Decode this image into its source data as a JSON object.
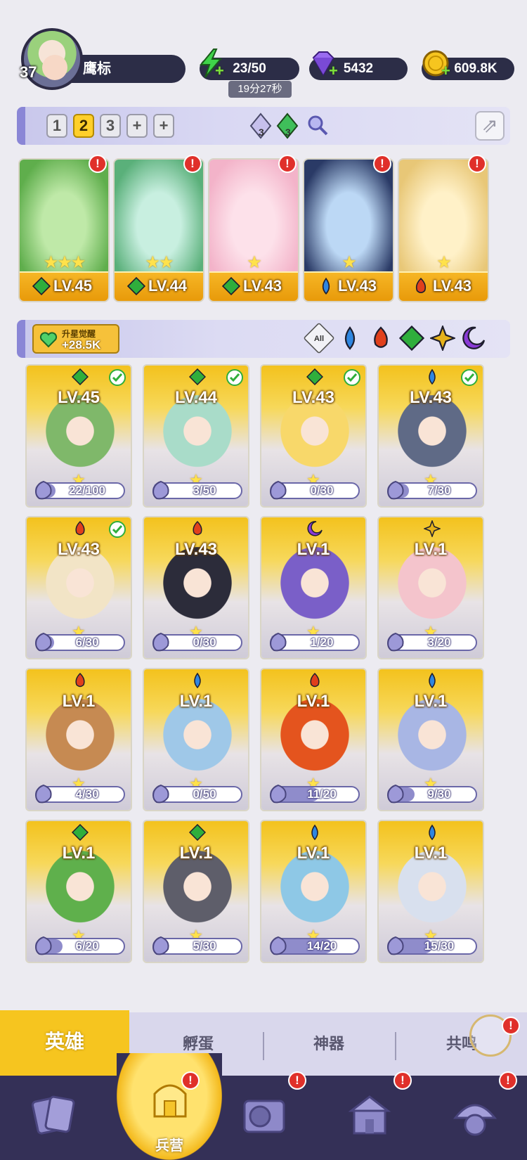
{
  "player": {
    "level": "37",
    "name": "鹰标"
  },
  "resources": {
    "energy": {
      "value": "23/50",
      "timer": "19分27秒",
      "icon": "lightning-icon"
    },
    "gems": {
      "value": "5432",
      "icon": "gem-icon"
    },
    "gold": {
      "value": "609.8K",
      "icon": "coin-icon"
    }
  },
  "team_bar": {
    "teams": [
      "1",
      "2",
      "3",
      "+",
      "+"
    ],
    "active_team": "2",
    "crystals": [
      {
        "icon": "ice-crystal-icon",
        "count": "3"
      },
      {
        "icon": "green-crystal-icon",
        "count": "3"
      }
    ]
  },
  "team_heroes": [
    {
      "level": "LV.45",
      "element": "leaf",
      "stars": "★★★",
      "alert": "!"
    },
    {
      "level": "LV.44",
      "element": "leaf",
      "stars": "★★",
      "alert": "!"
    },
    {
      "level": "LV.43",
      "element": "leaf",
      "stars": "★",
      "alert": "!"
    },
    {
      "level": "LV.43",
      "element": "water",
      "stars": "★",
      "alert": "!"
    },
    {
      "level": "LV.43",
      "element": "fire",
      "stars": "★",
      "alert": "!"
    }
  ],
  "filter_bar": {
    "awaken_title": "升星觉醒",
    "awaken_value": "+28.5K",
    "filters": [
      "All",
      "water",
      "fire",
      "leaf",
      "light",
      "dark"
    ],
    "all_label": "All"
  },
  "heroes": [
    {
      "level": "LV.45",
      "element": "leaf",
      "check": true,
      "shards": "22/100",
      "progress": 0.22
    },
    {
      "level": "LV.44",
      "element": "leaf",
      "check": true,
      "shards": "3/50",
      "progress": 0.06
    },
    {
      "level": "LV.43",
      "element": "leaf",
      "check": true,
      "shards": "0/30",
      "progress": 0.0
    },
    {
      "level": "LV.43",
      "element": "water",
      "check": true,
      "shards": "7/30",
      "progress": 0.23
    },
    {
      "level": "LV.43",
      "element": "fire",
      "check": true,
      "shards": "6/30",
      "progress": 0.2
    },
    {
      "level": "LV.43",
      "element": "fire",
      "check": false,
      "shards": "0/30",
      "progress": 0.0
    },
    {
      "level": "LV.1",
      "element": "dark",
      "check": false,
      "shards": "1/20",
      "progress": 0.05
    },
    {
      "level": "LV.1",
      "element": "light",
      "check": false,
      "shards": "3/20",
      "progress": 0.15
    },
    {
      "level": "LV.1",
      "element": "fire",
      "check": false,
      "shards": "4/30",
      "progress": 0.13
    },
    {
      "level": "LV.1",
      "element": "water",
      "check": false,
      "shards": "0/50",
      "progress": 0.0
    },
    {
      "level": "LV.1",
      "element": "fire",
      "check": false,
      "shards": "11/20",
      "progress": 0.55
    },
    {
      "level": "LV.1",
      "element": "water",
      "check": false,
      "shards": "9/30",
      "progress": 0.3
    },
    {
      "level": "LV.1",
      "element": "leaf",
      "check": false,
      "shards": "6/20",
      "progress": 0.3
    },
    {
      "level": "LV.1",
      "element": "leaf",
      "check": false,
      "shards": "5/30",
      "progress": 0.17
    },
    {
      "level": "LV.1",
      "element": "water",
      "check": false,
      "shards": "14/20",
      "progress": 0.7
    },
    {
      "level": "LV.1",
      "element": "water",
      "check": false,
      "shards": "15/30",
      "progress": 0.5
    }
  ],
  "sub_tabs": [
    {
      "label": "英雄",
      "active": true
    },
    {
      "label": "孵蛋",
      "active": false
    },
    {
      "label": "神器",
      "active": false
    },
    {
      "label": "共鸣",
      "active": false
    }
  ],
  "bottom_nav": [
    {
      "icon": "cards-icon",
      "label": "",
      "active": false,
      "alert": ""
    },
    {
      "icon": "barracks-icon",
      "label": "兵营",
      "active": true,
      "alert": "!"
    },
    {
      "icon": "map-icon",
      "label": "",
      "active": false,
      "alert": "!"
    },
    {
      "icon": "shop-icon",
      "label": "",
      "active": false,
      "alert": "!"
    },
    {
      "icon": "guild-icon",
      "label": "",
      "active": false,
      "alert": "!"
    }
  ],
  "colors": {
    "leaf": "#2fae3c",
    "water": "#2f86e0",
    "fire": "#e0401c",
    "dark": "#8a3bd6",
    "light": "#e6b21a",
    "accent": "#f6c51f",
    "nav_bg": "#343057"
  }
}
